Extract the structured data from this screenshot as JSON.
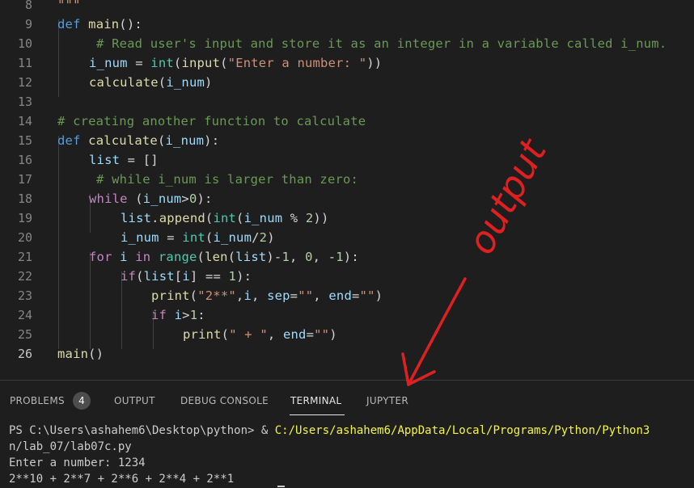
{
  "editor": {
    "lines": [
      {
        "n": "8",
        "text": "\"\"\""
      },
      {
        "n": "9"
      },
      {
        "n": "10"
      },
      {
        "n": "11"
      },
      {
        "n": "12"
      },
      {
        "n": "13"
      },
      {
        "n": "14"
      },
      {
        "n": "15"
      },
      {
        "n": "16"
      },
      {
        "n": "17"
      },
      {
        "n": "18"
      },
      {
        "n": "19"
      },
      {
        "n": "20"
      },
      {
        "n": "21"
      },
      {
        "n": "22"
      },
      {
        "n": "23"
      },
      {
        "n": "24"
      },
      {
        "n": "25"
      },
      {
        "n": "26"
      }
    ],
    "code": {
      "l9_def": "def",
      "l9_fn": "main",
      "l9_rest": "():",
      "l10": "# Read user's input and store it as an integer in a variable called i_num.",
      "l11_var": "i_num",
      "l11_eq": " = ",
      "l11_int": "int",
      "l11_p1": "(",
      "l11_input": "input",
      "l11_p2": "(",
      "l11_str": "\"Enter a number: \"",
      "l11_p3": "))",
      "l12_fn": "calculate",
      "l12_p1": "(",
      "l12_var": "i_num",
      "l12_p2": ")",
      "l14": "# creating another function to calculate",
      "l15_def": "def",
      "l15_fn": "calculate",
      "l15_p1": "(",
      "l15_var": "i_num",
      "l15_p2": "):",
      "l16_var": "list",
      "l16_rest": " = []",
      "l17": "# while i_num is larger than zero:",
      "l18_kw": "while",
      "l18_p1": " (",
      "l18_var": "i_num",
      "l18_op": ">",
      "l18_num": "0",
      "l18_p2": "):",
      "l19_var": "list",
      "l19_dot": ".",
      "l19_fn": "append",
      "l19_p1": "(",
      "l19_int": "int",
      "l19_p2": "(",
      "l19_var2": "i_num",
      "l19_op": " % ",
      "l19_num": "2",
      "l19_p3": "))",
      "l20_var": "i_num",
      "l20_eq": " = ",
      "l20_int": "int",
      "l20_p1": "(",
      "l20_var2": "i_num",
      "l20_op": "/",
      "l20_num": "2",
      "l20_p2": ")",
      "l21_for": "for",
      "l21_sp1": " ",
      "l21_i": "i",
      "l21_sp2": " ",
      "l21_in": "in",
      "l21_sp3": " ",
      "l21_range": "range",
      "l21_p1": "(",
      "l21_len": "len",
      "l21_p2": "(",
      "l21_list": "list",
      "l21_p3": ")-",
      "l21_n1": "1",
      "l21_c1": ", ",
      "l21_n2": "0",
      "l21_c2": ", -",
      "l21_n3": "1",
      "l21_p4": "):",
      "l22_if": "if",
      "l22_p1": "(",
      "l22_list": "list",
      "l22_b1": "[",
      "l22_i": "i",
      "l22_b2": "]",
      "l22_op": " == ",
      "l22_num": "1",
      "l22_p2": "):",
      "l23_fn": "print",
      "l23_p1": "(",
      "l23_str": "\"2**\"",
      "l23_c1": ",",
      "l23_i": "i",
      "l23_c2": ", ",
      "l23_sep": "sep",
      "l23_eq1": "=",
      "l23_s2": "\"\"",
      "l23_c3": ", ",
      "l23_end": "end",
      "l23_eq2": "=",
      "l23_s3": "\"\"",
      "l23_p2": ")",
      "l24_if": "if",
      "l24_sp": " ",
      "l24_i": "i",
      "l24_op": ">",
      "l24_num": "1",
      "l24_colon": ":",
      "l25_fn": "print",
      "l25_p1": "(",
      "l25_str": "\" + \"",
      "l25_c1": ", ",
      "l25_end": "end",
      "l25_eq": "=",
      "l25_s2": "\"\"",
      "l25_p2": ")",
      "l26_fn": "main",
      "l26_p": "()"
    }
  },
  "panel": {
    "tabs": [
      {
        "label": "PROBLEMS",
        "badge": "4"
      },
      {
        "label": "OUTPUT"
      },
      {
        "label": "DEBUG CONSOLE"
      },
      {
        "label": "TERMINAL",
        "active": true
      },
      {
        "label": "JUPYTER"
      }
    ],
    "terminal": {
      "prompt": "PS C:\\Users\\ashahem6\\Desktop\\python> & ",
      "command_path": "C:/Users/ashahem6/AppData/Local/Programs/Python/Python3",
      "line2": "n/lab_07/lab07c.py",
      "line3": "Enter a number: 1234",
      "line4": "2**10 + 2**7 + 2**6 + 2**4 + 2**1"
    }
  },
  "annotation": {
    "text": "output",
    "color": "#e02020"
  }
}
